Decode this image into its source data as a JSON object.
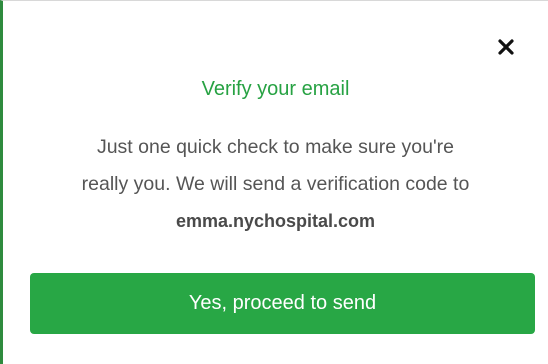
{
  "dialog": {
    "close_icon": "close-icon",
    "title": "Verify your email",
    "message_line1": "Just one quick check to make sure you're",
    "message_line2": "really you. We will send a verification code to",
    "email": "emma.nychospital.com",
    "confirm_label": "Yes, proceed to send"
  },
  "colors": {
    "accent": "#28a745",
    "title": "#27a243",
    "text": "#555555"
  }
}
